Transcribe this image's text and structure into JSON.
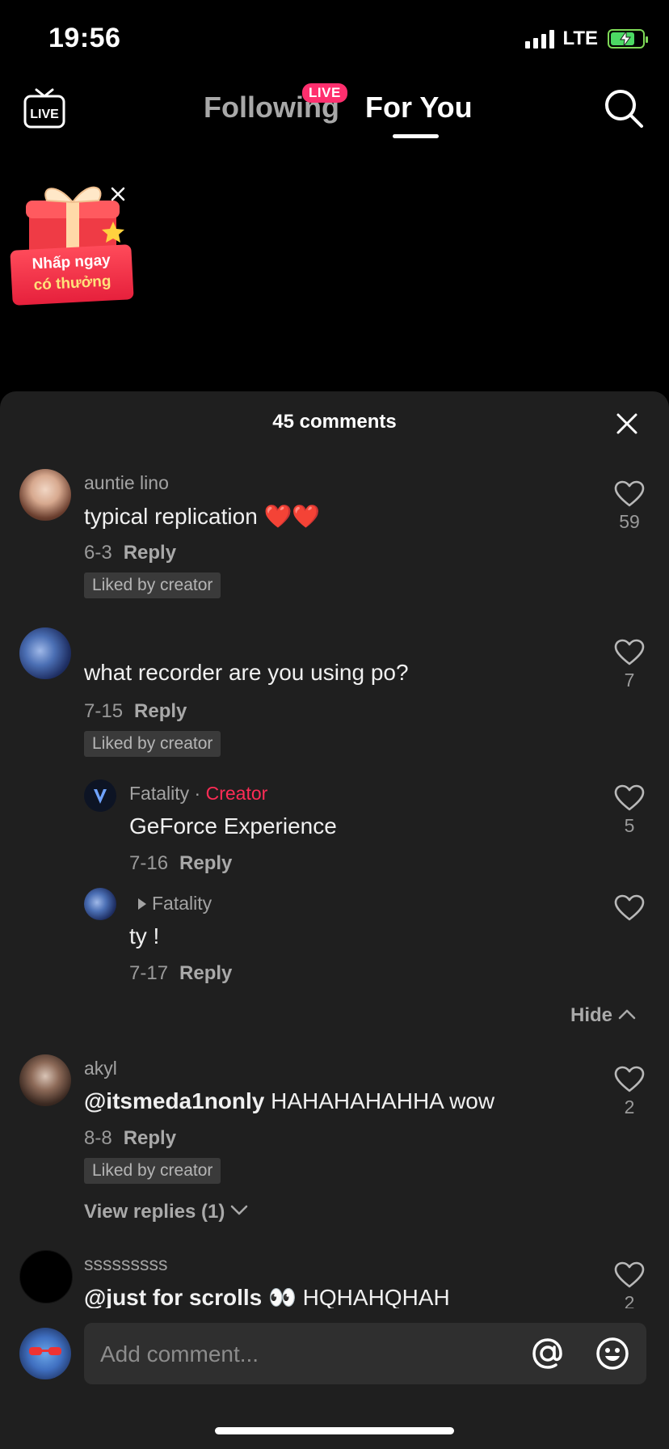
{
  "status_bar": {
    "time": "19:56",
    "network": "LTE"
  },
  "top_nav": {
    "tabs": [
      {
        "label": "Following",
        "badge": "LIVE"
      },
      {
        "label": "For You",
        "active": true
      }
    ]
  },
  "promo": {
    "line1": "Nhấp ngay",
    "line2": "có thưởng"
  },
  "comments_panel": {
    "title": "45 comments",
    "comments": [
      {
        "username": "auntie lino",
        "text": "typical replication ❤️❤️",
        "date": "6-3",
        "reply": "Reply",
        "tag": "Liked by creator",
        "likes": "59"
      },
      {
        "username": "",
        "text": "what recorder are you using po?",
        "date": "7-15",
        "reply": "Reply",
        "tag": "Liked by creator",
        "likes": "7",
        "replies": [
          {
            "username": "Fatality",
            "separator": "·",
            "role": "Creator",
            "text": "GeForce Experience",
            "date": "7-16",
            "reply": "Reply",
            "likes": "5"
          },
          {
            "reply_to": "Fatality",
            "text": "ty !",
            "date": "7-17",
            "reply": "Reply",
            "likes": ""
          }
        ],
        "hide_label": "Hide"
      },
      {
        "username": "akyl",
        "mention": "@itsmeda1nonly",
        "text": " HAHAHAHAHHA wow",
        "date": "8-8",
        "reply": "Reply",
        "tag": "Liked by creator",
        "likes": "2",
        "view_replies": "View replies (1)"
      },
      {
        "username": "sssssssss",
        "mention": "@just for scrolls",
        "text": " 👀 HQHAHQHAH",
        "likes": "2"
      }
    ],
    "input_placeholder": "Add comment..."
  },
  "colors": {
    "accent": "#fe2c55",
    "sheet_bg": "#1f1f1f",
    "live_badge": "#ff2f6e"
  },
  "icons": [
    "live-tv-icon",
    "search-icon",
    "close-icon",
    "heart-icon",
    "at-icon",
    "emoji-icon",
    "gift-icon"
  ]
}
